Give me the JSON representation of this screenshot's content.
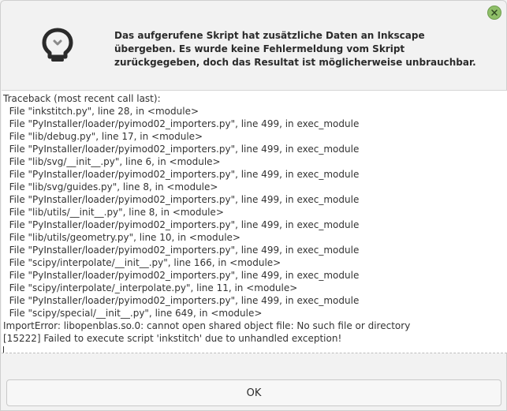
{
  "dialog": {
    "close_icon": "close-icon",
    "header_icon": "lightbulb-icon",
    "message": "Das aufgerufene Skript hat zusätzliche Daten an Inkscape übergeben. Es wurde keine Fehlermeldung vom Skript zurückgegeben, doch das Resultat ist möglicherweise unbrauchbar."
  },
  "output": {
    "lines": [
      "Traceback (most recent call last):",
      "  File \"inkstitch.py\", line 28, in <module>",
      "  File \"PyInstaller/loader/pyimod02_importers.py\", line 499, in exec_module",
      "  File \"lib/debug.py\", line 17, in <module>",
      "  File \"PyInstaller/loader/pyimod02_importers.py\", line 499, in exec_module",
      "  File \"lib/svg/__init__.py\", line 6, in <module>",
      "  File \"PyInstaller/loader/pyimod02_importers.py\", line 499, in exec_module",
      "  File \"lib/svg/guides.py\", line 8, in <module>",
      "  File \"PyInstaller/loader/pyimod02_importers.py\", line 499, in exec_module",
      "  File \"lib/utils/__init__.py\", line 8, in <module>",
      "  File \"PyInstaller/loader/pyimod02_importers.py\", line 499, in exec_module",
      "  File \"lib/utils/geometry.py\", line 10, in <module>",
      "  File \"PyInstaller/loader/pyimod02_importers.py\", line 499, in exec_module",
      "  File \"scipy/interpolate/__init__.py\", line 166, in <module>",
      "  File \"PyInstaller/loader/pyimod02_importers.py\", line 499, in exec_module",
      "  File \"scipy/interpolate/_interpolate.py\", line 11, in <module>",
      "  File \"PyInstaller/loader/pyimod02_importers.py\", line 499, in exec_module",
      "  File \"scipy/special/__init__.py\", line 649, in <module>",
      "ImportError: libopenblas.so.0: cannot open shared object file: No such file or directory",
      "[15222] Failed to execute script 'inkstitch' due to unhandled exception!"
    ]
  },
  "buttons": {
    "ok_label": "OK"
  },
  "colors": {
    "close_button": "#8fbf68",
    "background": "#f2f2f2",
    "output_background": "#ffffff"
  }
}
